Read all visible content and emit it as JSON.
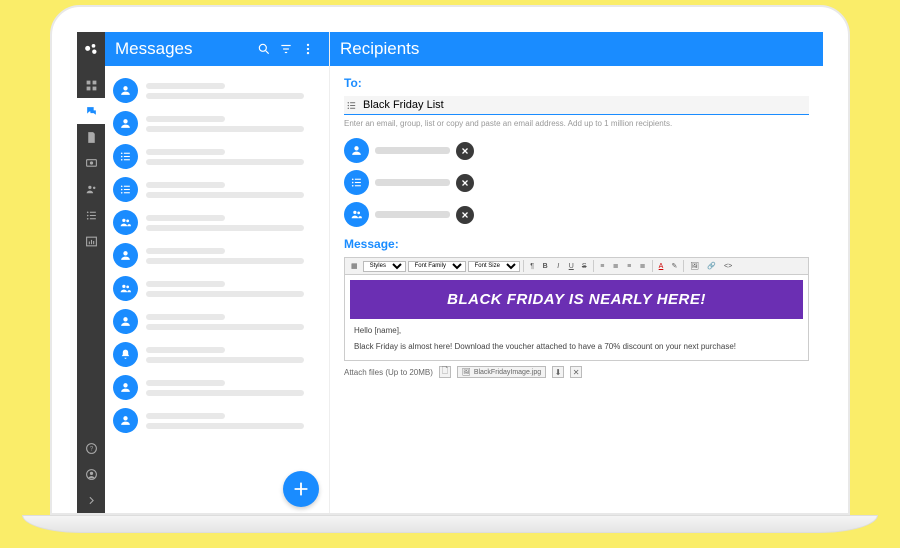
{
  "header": {
    "left_title": "Messages",
    "right_title": "Recipients"
  },
  "compose": {
    "to_label": "To:",
    "to_value": "Black Friday List",
    "to_hint": "Enter an email, group, list or copy and paste an email address.  Add up to 1 million recipients.",
    "message_label": "Message:",
    "banner": "BLACK FRIDAY IS NEARLY HERE!",
    "greeting": "Hello [name],",
    "body": "Black Friday is almost here! Download the voucher attached to have a 70% discount on your next purchase!"
  },
  "toolbar": {
    "styles": "Styles",
    "font_family": "Font Family",
    "font_size": "Font Size"
  },
  "attach": {
    "label": "Attach files (Up to 20MB)",
    "file": "BlackFridayImage.jpg"
  },
  "icons": {
    "person": "person",
    "list": "list",
    "group": "group",
    "bell": "bell"
  }
}
